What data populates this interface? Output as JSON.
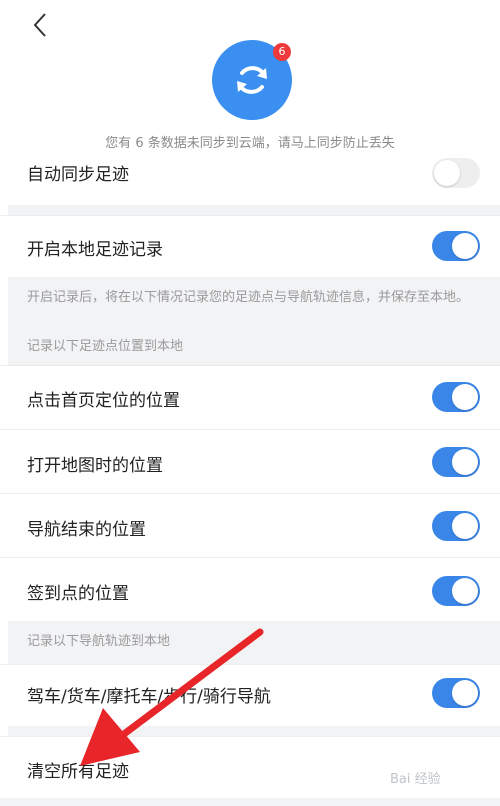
{
  "header": {
    "back_icon": "chevron-left-icon",
    "sync_icon": "sync-icon",
    "badge_count": "6",
    "notice": "您有 6 条数据未同步到云端，请马上同步防止丢失"
  },
  "settings": {
    "auto_sync": {
      "label": "自动同步足迹",
      "enabled": false
    },
    "local_record": {
      "label": "开启本地足迹记录",
      "enabled": true
    },
    "local_record_hint": "开启记录后，将在以下情况记录您的足迹点与导航轨迹信息，并保存至本地。",
    "points_section": "记录以下足迹点位置到本地",
    "points": [
      {
        "label": "点击首页定位的位置",
        "enabled": true
      },
      {
        "label": "打开地图时的位置",
        "enabled": true
      },
      {
        "label": "导航结束的位置",
        "enabled": true
      },
      {
        "label": "签到点的位置",
        "enabled": true
      }
    ],
    "tracks_section": "记录以下导航轨迹到本地",
    "tracks": {
      "label": "驾车/货车/摩托车/步行/骑行导航",
      "enabled": true
    },
    "clear": "清空所有足迹"
  },
  "annotation": {
    "arrow_color": "#e8262a"
  },
  "watermark": "Bai 经验"
}
